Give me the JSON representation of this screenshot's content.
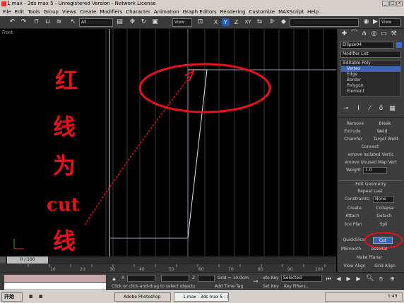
{
  "window": {
    "title": "1.max - 3ds max 5 - Unregistered Version - Network License"
  },
  "menu": [
    "File",
    "Edit",
    "Tools",
    "Group",
    "Views",
    "Create",
    "Modifiers",
    "Character",
    "Animation",
    "Graph Editors",
    "Rendering",
    "Customize",
    "MAXScript",
    "Help"
  ],
  "toolbar": {
    "selection_filter": "All",
    "ref_coord": "View",
    "axis_x": "X",
    "axis_y": "Y",
    "axis_z": "Z",
    "axis_xy": "XY",
    "view_dropdown": "View"
  },
  "viewport": {
    "label": "Front"
  },
  "annotation": {
    "lines": [
      "红",
      "线",
      "为",
      "cut",
      "线"
    ]
  },
  "panel": {
    "object_name": "Ellipse04",
    "modifier_list": "Modifier List",
    "stack": [
      "Editable Poly",
      "Vertex",
      "Edge",
      "Border",
      "Polygon",
      "Element"
    ],
    "remove": "Remove",
    "break": "Break",
    "extrude": "Extrude",
    "weld": "Weld",
    "chamfer": "Chamfer",
    "target_weld": "Target Weld",
    "connect": "Connect",
    "remove_isolated": "emove Isolated Vertic",
    "remove_unused": "emove Unused Map Vert",
    "weight_label": "Weight",
    "weight_value": "1.0",
    "edit_geometry": "Edit Geometry",
    "repeat_last": "Repeat Last",
    "constraints": "Constraints:",
    "constraints_value": "None",
    "create": "Create",
    "collapse": "Collapse",
    "attach": "Attach",
    "detach": "Detach",
    "slice_plane": "lice Plan",
    "split": "Spli",
    "quickslice": "QuickSlice",
    "cut": "Cut",
    "msmooth": "MSmooth",
    "tessellate": "essellat",
    "make_planar": "Make Planar",
    "view_align": "View Align",
    "grid_align": "Grid Align"
  },
  "timeline": {
    "frame": "0 / 100",
    "ticks": [
      "10",
      "20",
      "30",
      "40",
      "50",
      "60",
      "70",
      "80",
      "90",
      "100"
    ]
  },
  "status": {
    "x_label": "X",
    "z_label": "Z",
    "grid": "Grid = 10.0cm",
    "prompt": "Click or click-and-drag to select objects",
    "add_time_tag": "Add Time Tag",
    "auto_key": "uto Key",
    "selected": "Selected",
    "set_key": "Set Key",
    "key_filters": "Key Filters..."
  },
  "taskbar": {
    "start": "开始",
    "tasks": [
      "Adobe Photoshop",
      "1.max - 3ds max 5 - Unre..."
    ],
    "clock": "1:43"
  }
}
